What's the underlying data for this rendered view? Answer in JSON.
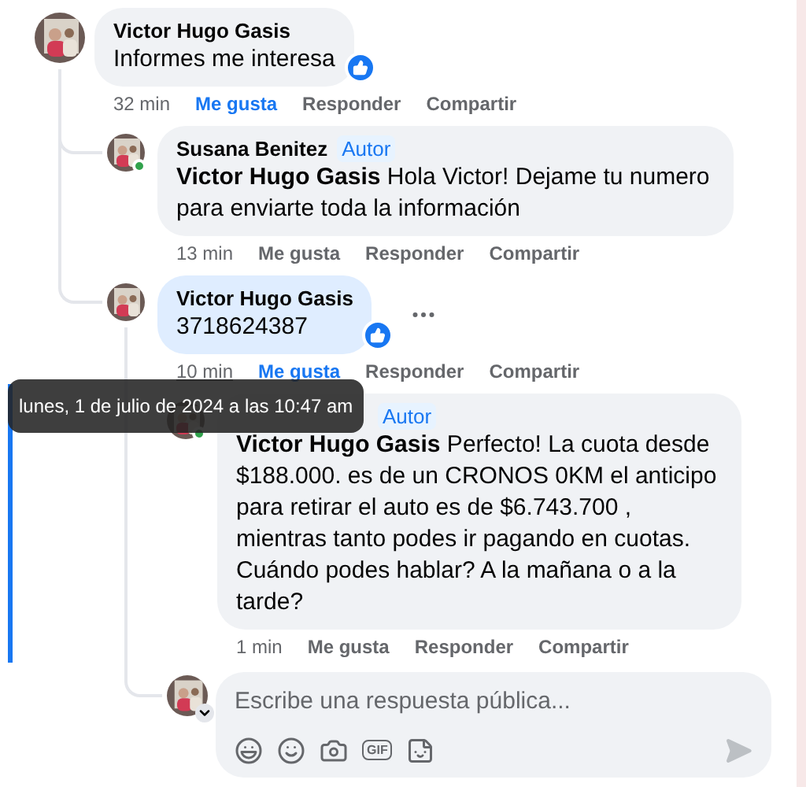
{
  "comments": [
    {
      "author": "Victor Hugo Gasis",
      "text": "Informes me interesa",
      "reaction": true,
      "bubble_highlighted": false,
      "online": false,
      "more_menu": false,
      "time": "32 min",
      "time_hovered": false,
      "liked": true,
      "actions": [
        "Me gusta",
        "Responder",
        "Compartir"
      ],
      "children": [
        {
          "author": "Susana Benitez",
          "badge": "Autor",
          "text": "**Victor Hugo Gasis** Hola Victor! Dejame tu numero para enviarte toda la información",
          "reaction": false,
          "bubble_highlighted": false,
          "online": true,
          "more_menu": false,
          "time": "13 min",
          "time_hovered": false,
          "liked": false,
          "actions": [
            "Me gusta",
            "Responder",
            "Compartir"
          ]
        },
        {
          "author": "Victor Hugo Gasis",
          "text": "3718624387",
          "reaction": true,
          "bubble_highlighted": true,
          "online": false,
          "more_menu": true,
          "time": "10 min",
          "time_hovered": true,
          "liked": true,
          "actions": [
            "Me gusta",
            "Responder",
            "Compartir"
          ],
          "children": [
            {
              "badge": "Autor",
              "text": "**Victor Hugo Gasis** Perfecto! La cuota desde $188.000. es de un CRONOS 0KM el anticipo para retirar el auto es de $6.743.700 , mientras tanto podes ir pagando en cuotas. Cuándo podes hablar? A la mañana o a la tarde?",
              "reaction": false,
              "bubble_highlighted": false,
              "online": true,
              "more_menu": false,
              "highlighted": true,
              "time": "1 min",
              "time_hovered": false,
              "liked": false,
              "actions": [
                "Me gusta",
                "Responder",
                "Compartir"
              ]
            }
          ]
        }
      ]
    }
  ],
  "tooltip": {
    "text": "lunes, 1 de julio de 2024 a las 10:47 am"
  },
  "composer": {
    "placeholder": "Escribe una respuesta pública...",
    "gif_label": "GIF"
  }
}
